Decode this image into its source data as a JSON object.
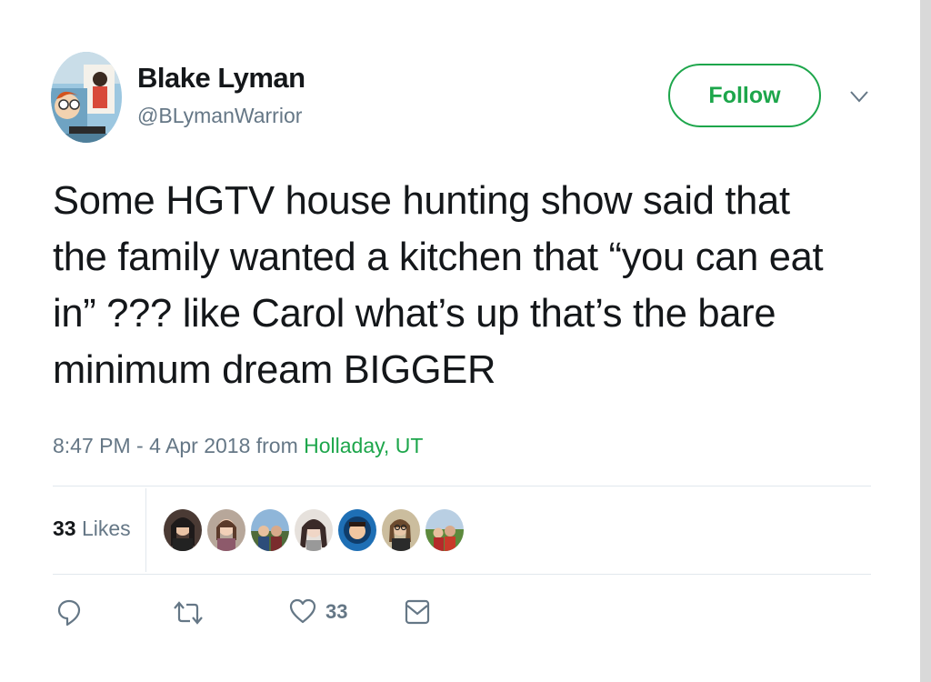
{
  "user": {
    "display_name": "Blake Lyman",
    "handle": "@BLymanWarrior"
  },
  "header": {
    "follow_label": "Follow"
  },
  "tweet": {
    "lines": [
      "Some HGTV house hunting show said that",
      "the family wanted a kitchen that “you can eat",
      "in” ??? like Carol what’s up that’s the bare",
      "minimum dream BIGGER"
    ]
  },
  "meta": {
    "time": "8:47 PM - 4 Apr 2018 from ",
    "location": "Holladay, UT"
  },
  "stats": {
    "likes_count": "33",
    "likes_label": "Likes"
  },
  "actions": {
    "like_count": "33"
  },
  "icons": {
    "reply": "reply-icon",
    "retweet": "retweet-icon",
    "like": "heart-icon",
    "dm": "envelope-icon",
    "caret": "chevron-down-icon"
  },
  "colors": {
    "accent_green": "#1da64b",
    "muted_text": "#657786",
    "text": "#14171a",
    "divider": "#e1e8ed"
  }
}
